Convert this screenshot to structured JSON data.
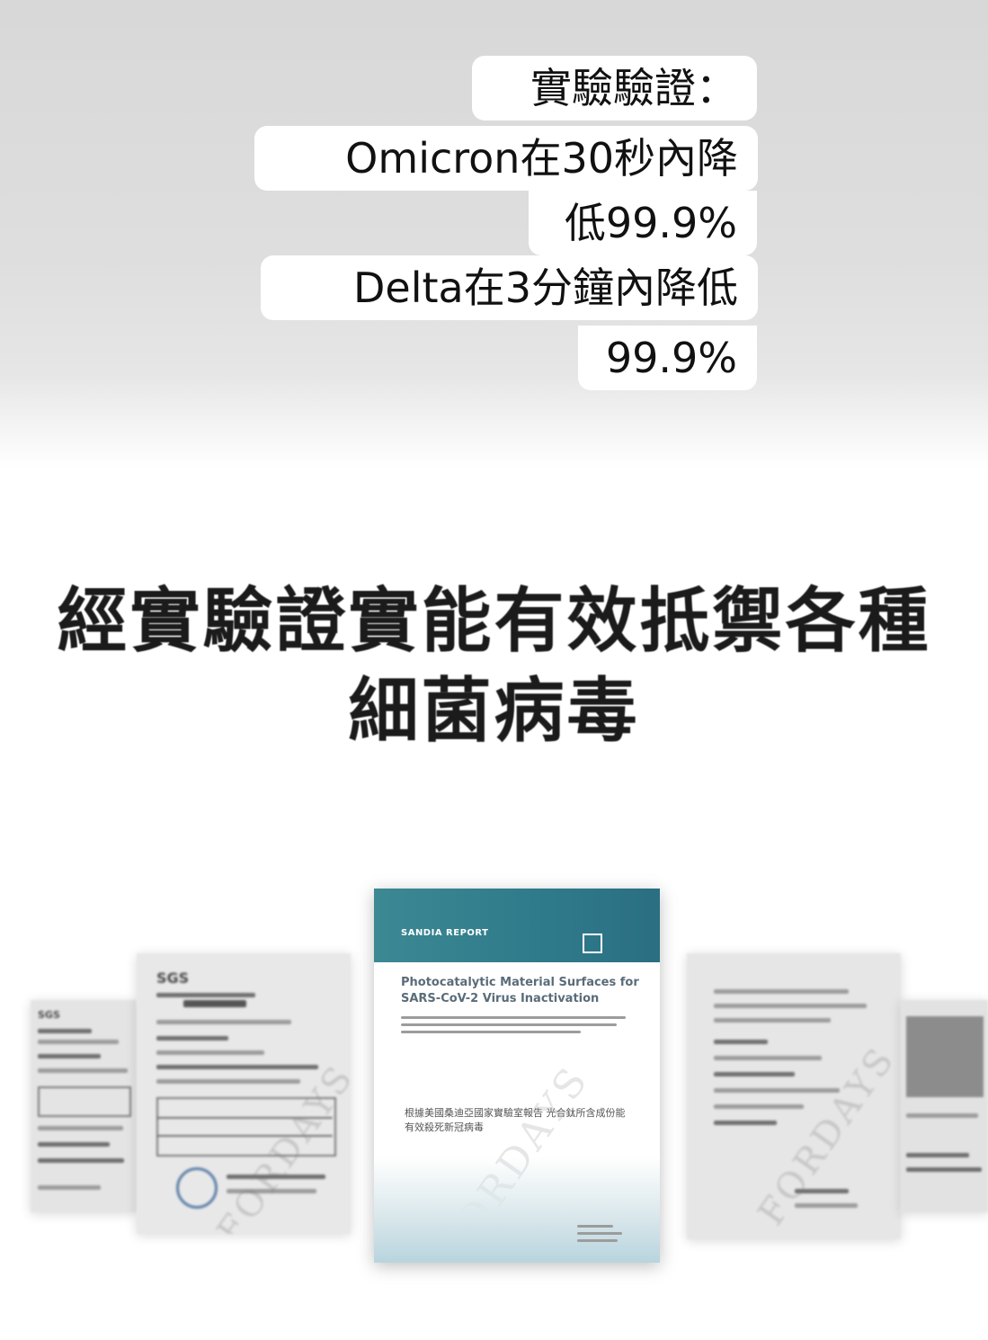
{
  "callout": {
    "lines": [
      "實驗驗證：",
      "Omicron在30秒內降",
      "低99.9%",
      "Delta在3分鐘內降低",
      "99.9%"
    ]
  },
  "headline": {
    "line1": "經實驗證實能有效抵禦各種",
    "line2": "細菌病毒"
  },
  "documents": {
    "left_far": {
      "logo": "SGS"
    },
    "left_near": {
      "logo": "SGS"
    },
    "center_report": {
      "series_label": "SANDIA REPORT",
      "title": "Photocatalytic Material Surfaces for SARS-CoV-2 Virus Inactivation",
      "chinese_caption": "根據美國桑迪亞國家實驗室報告 光合鈦所含成份能有效殺死新冠病毒"
    },
    "watermark": "FORDAYS"
  },
  "colors": {
    "report_header": "#2f7a8a",
    "bubble": "#ffffff",
    "background_top": "#d8d8d8"
  }
}
